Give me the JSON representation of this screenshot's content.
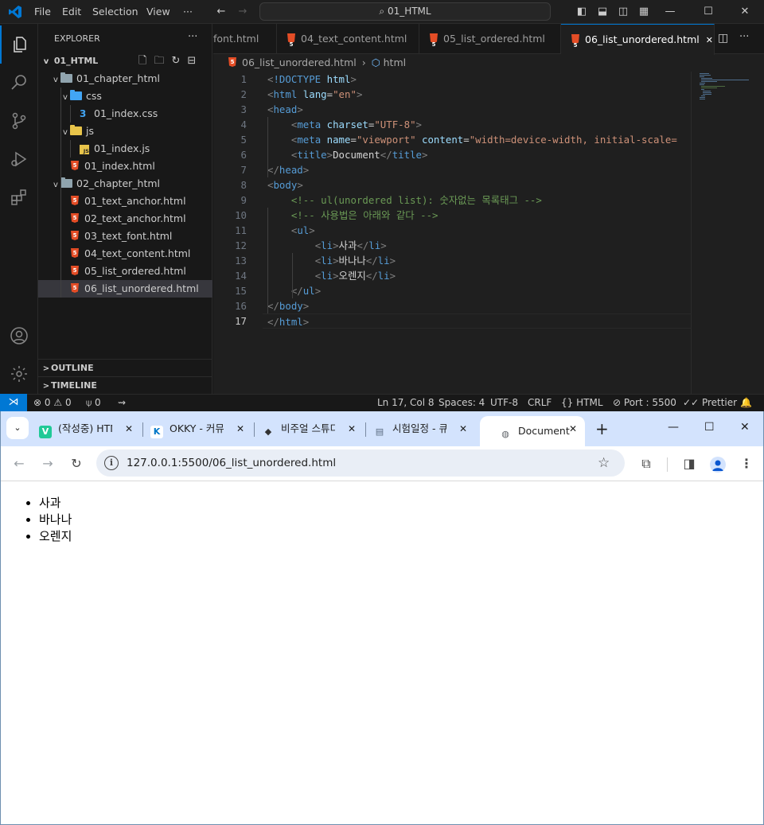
{
  "vscode": {
    "menu": [
      "File",
      "Edit",
      "Selection",
      "View",
      "···"
    ],
    "command_center": "01_HTML",
    "explorer_title": "EXPLORER",
    "explorer_more": "···",
    "workspace": "01_HTML",
    "tree": [
      {
        "label": "01_chapter_html",
        "type": "folder"
      },
      {
        "label": "css",
        "type": "folder"
      },
      {
        "label": "01_index.css",
        "type": "css"
      },
      {
        "label": "js",
        "type": "folder"
      },
      {
        "label": "01_index.js",
        "type": "js"
      },
      {
        "label": "01_index.html",
        "type": "html"
      },
      {
        "label": "02_chapter_html",
        "type": "folder"
      },
      {
        "label": "01_text_anchor.html",
        "type": "html"
      },
      {
        "label": "02_text_anchor.html",
        "type": "html"
      },
      {
        "label": "03_text_font.html",
        "type": "html"
      },
      {
        "label": "04_text_content.html",
        "type": "html"
      },
      {
        "label": "05_list_ordered.html",
        "type": "html"
      },
      {
        "label": "06_list_unordered.html",
        "type": "html",
        "selected": true
      }
    ],
    "outline": "OUTLINE",
    "timeline": "TIMELINE",
    "tabs": [
      "font.html",
      "04_text_content.html",
      "05_list_ordered.html",
      "06_list_unordered.html"
    ],
    "tab_close": "✕",
    "breadcrumb": {
      "file": "06_list_unordered.html",
      "symbol": "html"
    },
    "code_lines": [
      {
        "n": 1,
        "html": "<span class='ab'>&lt;</span><span class='t'>!DOCTYPE</span> <span class='at'>html</span><span class='ab'>&gt;</span>"
      },
      {
        "n": 2,
        "html": "<span class='ab'>&lt;</span><span class='t'>html</span> <span class='at'>lang</span>=<span class='s'>\"en\"</span><span class='ab'>&gt;</span>"
      },
      {
        "n": 3,
        "html": "<span class='ab'>&lt;</span><span class='t'>head</span><span class='ab'>&gt;</span>"
      },
      {
        "n": 4,
        "html": "    <span class='ab'>&lt;</span><span class='t'>meta</span> <span class='at'>charset</span>=<span class='s'>\"UTF-8\"</span><span class='ab'>&gt;</span>"
      },
      {
        "n": 5,
        "html": "    <span class='ab'>&lt;</span><span class='t'>meta</span> <span class='at'>name</span>=<span class='s'>\"viewport\"</span> <span class='at'>content</span>=<span class='s'>\"width=device-width, initial-scale=</span>"
      },
      {
        "n": 6,
        "html": "    <span class='ab'>&lt;</span><span class='t'>title</span><span class='ab'>&gt;</span><span class='tx'>Document</span><span class='ab'>&lt;/</span><span class='t'>title</span><span class='ab'>&gt;</span>"
      },
      {
        "n": 7,
        "html": "<span class='ab'>&lt;/</span><span class='t'>head</span><span class='ab'>&gt;</span>"
      },
      {
        "n": 8,
        "html": "<span class='ab'>&lt;</span><span class='t'>body</span><span class='ab'>&gt;</span>"
      },
      {
        "n": 9,
        "html": "    <span class='c'>&lt;!-- ul(unordered list): 숫자없는 목록태그 --&gt;</span>"
      },
      {
        "n": 10,
        "html": "    <span class='c'>&lt;!-- 사용법은 아래와 같다 --&gt;</span>"
      },
      {
        "n": 11,
        "html": "    <span class='ab'>&lt;</span><span class='t'>ul</span><span class='ab'>&gt;</span>"
      },
      {
        "n": 12,
        "html": "        <span class='ab'>&lt;</span><span class='t'>li</span><span class='ab'>&gt;</span><span class='tx'>사과</span><span class='ab'>&lt;/</span><span class='t'>li</span><span class='ab'>&gt;</span>"
      },
      {
        "n": 13,
        "html": "        <span class='ab'>&lt;</span><span class='t'>li</span><span class='ab'>&gt;</span><span class='tx'>바나나</span><span class='ab'>&lt;/</span><span class='t'>li</span><span class='ab'>&gt;</span>"
      },
      {
        "n": 14,
        "html": "        <span class='ab'>&lt;</span><span class='t'>li</span><span class='ab'>&gt;</span><span class='tx'>오렌지</span><span class='ab'>&lt;/</span><span class='t'>li</span><span class='ab'>&gt;</span>"
      },
      {
        "n": 15,
        "html": "    <span class='ab'>&lt;/</span><span class='t'>ul</span><span class='ab'>&gt;</span>"
      },
      {
        "n": 16,
        "html": "<span class='ab'>&lt;/</span><span class='t'>body</span><span class='ab'>&gt;</span>"
      },
      {
        "n": 17,
        "html": "<span class='ab'>&lt;/</span><span class='t'>html</span><span class='ab'>&gt;</span>"
      }
    ],
    "current_line": 17,
    "status": {
      "errors": "0",
      "warnings": "0",
      "ports": "0",
      "position": "Ln 17, Col 8",
      "spaces": "Spaces: 4",
      "encoding": "UTF-8",
      "eol": "CRLF",
      "language": "HTML",
      "port": "Port : 5500",
      "prettier": "Prettier"
    }
  },
  "chrome": {
    "tabs": [
      {
        "title": "(작성중) HTML",
        "favicon": "V",
        "color": "#20c997"
      },
      {
        "title": "OKKY - 커뮤니",
        "favicon": "K",
        "color": "#0077c8"
      },
      {
        "title": "비주얼 스튜디",
        "favicon": "◆",
        "color": "#333333"
      },
      {
        "title": "시험일정 - 큐",
        "favicon": "▤",
        "color": "#5a6b80"
      },
      {
        "title": "Document",
        "favicon": "◍",
        "color": "#5f6368",
        "active": true
      }
    ],
    "tab_close": "✕",
    "new_tab": "+",
    "window": {
      "min": "—",
      "max": "☐",
      "close": "✕"
    },
    "url": "127.0.0.1:5500/06_list_unordered.html",
    "page_list": [
      "사과",
      "바나나",
      "오렌지"
    ]
  }
}
